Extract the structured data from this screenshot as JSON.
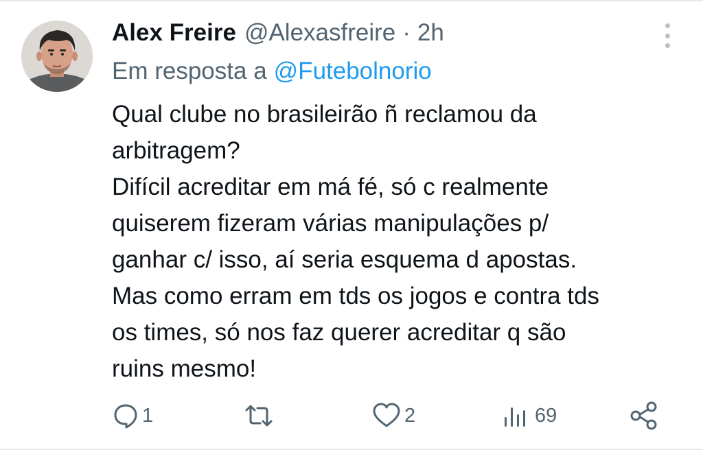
{
  "tweet": {
    "author": {
      "name": "Alex Freire",
      "handle": "@Alexasfreire",
      "avatar_icon": "user-avatar-photo"
    },
    "separator": "·",
    "time": "2h",
    "reply_to": {
      "prefix": "Em resposta a",
      "handle": "@Futebolnorio"
    },
    "text_lines": [
      "Qual clube no brasileirão ñ reclamou da",
      "arbitragem?",
      "Difícil acreditar em má fé, só c realmente",
      "quiserem fizeram várias manipulações p/",
      "ganhar c/ isso, aí seria esquema d apostas.",
      "Mas como erram em tds os jogos e contra tds",
      "os times, só nos faz querer acreditar q são",
      "ruins mesmo!"
    ],
    "actions": {
      "reply": {
        "icon": "reply-bubble-icon",
        "count": "1"
      },
      "retweet": {
        "icon": "retweet-icon",
        "count": ""
      },
      "like": {
        "icon": "heart-icon",
        "count": "2"
      },
      "views": {
        "icon": "views-bar-icon",
        "count": "69"
      },
      "share": {
        "icon": "share-icon"
      }
    }
  },
  "colors": {
    "text": "#0f1419",
    "secondary": "#536471",
    "link": "#1d9bf0",
    "divider": "#e6e9ec"
  }
}
